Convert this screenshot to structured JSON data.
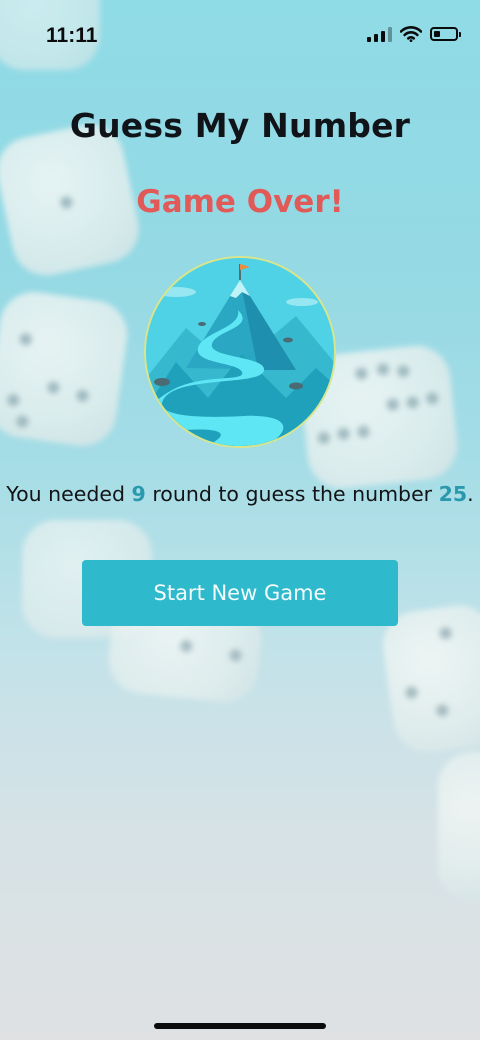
{
  "status_bar": {
    "time": "11:11",
    "battery_level": 0.3,
    "signal_bars": 4
  },
  "header": {
    "title": "Guess My Number"
  },
  "game": {
    "status": "Game Over!",
    "result_prefix": "You needed ",
    "rounds": "9",
    "result_middle": " round to guess the number ",
    "number": "25",
    "result_suffix": "."
  },
  "actions": {
    "start_new_game_label": "Start New Game"
  },
  "colors": {
    "accent": "#2eb9cc",
    "game_over": "#e25a58",
    "highlight": "#2a99ad"
  }
}
